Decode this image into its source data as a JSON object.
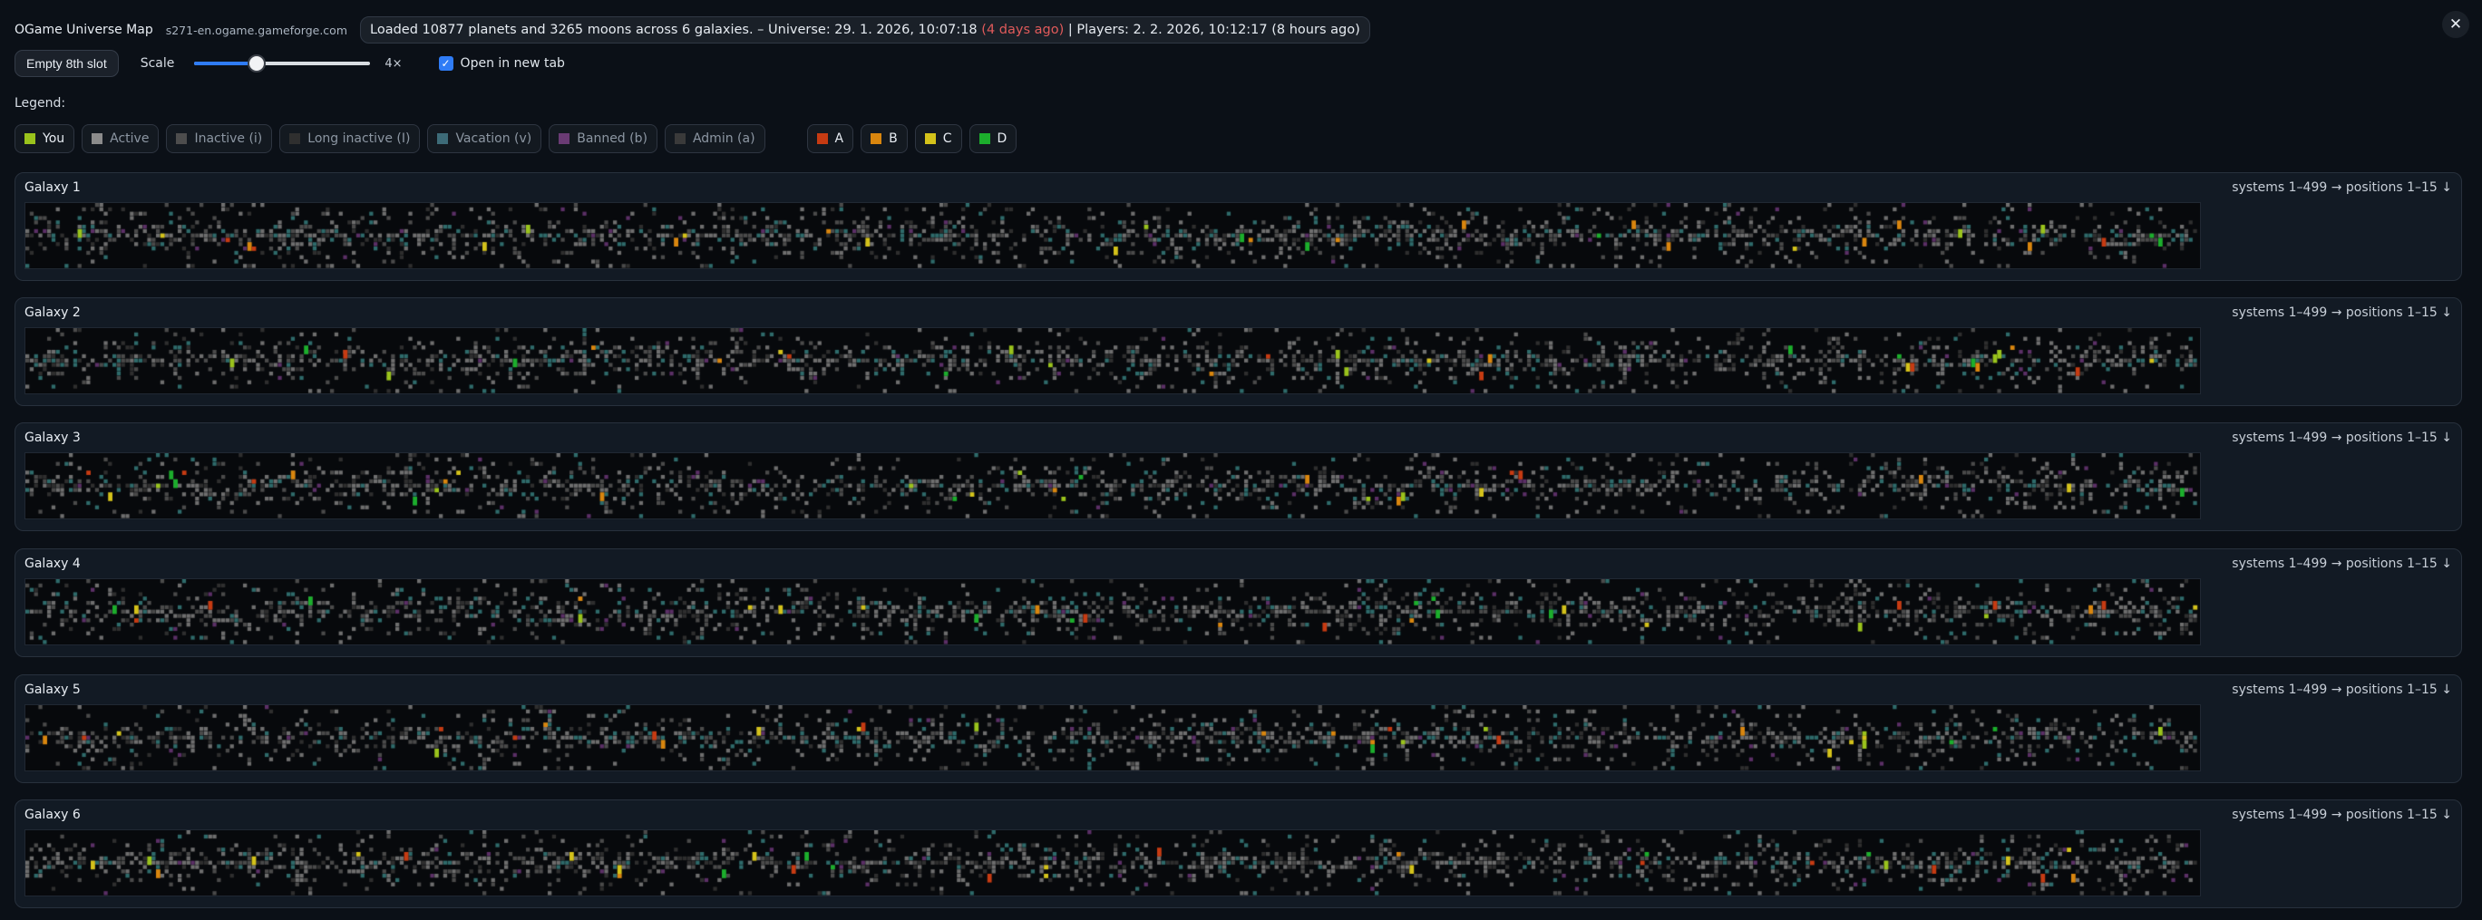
{
  "header": {
    "app_title": "OGame Universe Map",
    "host": "s271-en.ogame.gameforge.com",
    "status_main": "Loaded 10877 planets and 3265 moons across 6 galaxies. – Universe: 29. 1. 2026, 10:07:18 ",
    "status_ago": "(4 days ago)",
    "status_players": " | Players: 2. 2. 2026, 10:12:17 (8 hours ago)",
    "close_icon": "✕"
  },
  "controls": {
    "empty_slot_button": "Empty 8th slot",
    "scale_label": "Scale",
    "scale_value": "4×",
    "scale_fraction": 0.36,
    "open_new_tab_label": "Open in new tab",
    "open_new_tab_checked": true
  },
  "legend": {
    "title": "Legend:",
    "statuses": [
      {
        "label": "You",
        "color": "#9ac31c"
      },
      {
        "label": "Active",
        "color": "#8b8b8b"
      },
      {
        "label": "Inactive (i)",
        "color": "#4d4d4d"
      },
      {
        "label": "Long inactive (I)",
        "color": "#2f2f2f"
      },
      {
        "label": "Vacation (v)",
        "color": "#3d6b78"
      },
      {
        "label": "Banned (b)",
        "color": "#6a3b74"
      },
      {
        "label": "Admin (a)",
        "color": "#3a3a3a"
      }
    ],
    "alliances": [
      {
        "label": "A",
        "color": "#c63b12"
      },
      {
        "label": "B",
        "color": "#d9860e"
      },
      {
        "label": "C",
        "color": "#d4c21a"
      },
      {
        "label": "D",
        "color": "#1cae2c"
      }
    ]
  },
  "galaxies": [
    {
      "title": "Galaxy 1",
      "range": "systems 1–499 → positions 1–15 ↓"
    },
    {
      "title": "Galaxy 2",
      "range": "systems 1–499 → positions 1–15 ↓"
    },
    {
      "title": "Galaxy 3",
      "range": "systems 1–499 → positions 1–15 ↓"
    },
    {
      "title": "Galaxy 4",
      "range": "systems 1–499 → positions 1–15 ↓"
    },
    {
      "title": "Galaxy 5",
      "range": "systems 1–499 → positions 1–15 ↓"
    },
    {
      "title": "Galaxy 6",
      "range": "systems 1–499 → positions 1–15 ↓"
    }
  ],
  "map_colors": {
    "background": "#07090c",
    "active": "#6e6e6e",
    "inactive": "#4a4a4a",
    "long_inactive": "#2e2e2e",
    "vacation": "#2e6a6a",
    "banned": "#5b2f66"
  }
}
